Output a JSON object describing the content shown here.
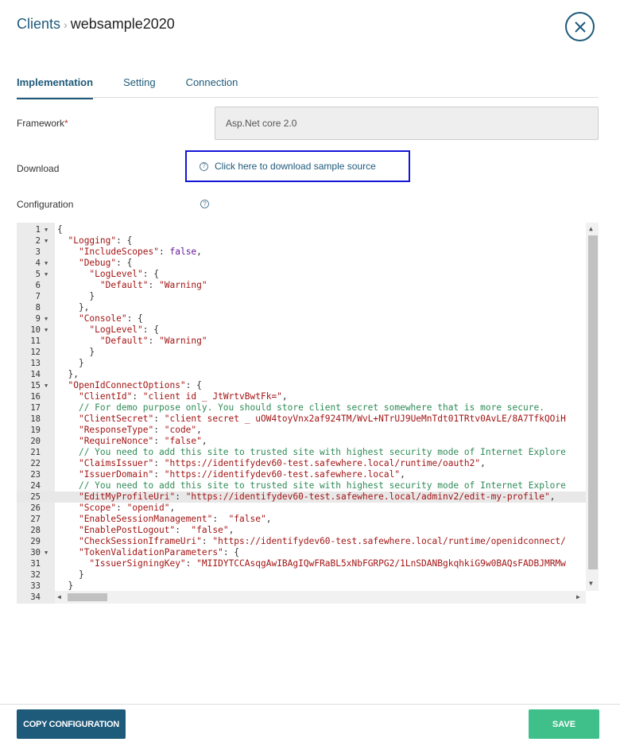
{
  "breadcrumb": {
    "parent": "Clients",
    "separator": "›",
    "current": "websample2020"
  },
  "tabs": [
    {
      "label": "Implementation",
      "active": true
    },
    {
      "label": "Setting",
      "active": false
    },
    {
      "label": "Connection",
      "active": false
    }
  ],
  "form": {
    "framework_label": "Framework",
    "required_mark": "*",
    "framework_value": "Asp.Net core 2.0",
    "download_label": "Download",
    "download_link": "Click here to download sample source",
    "configuration_label": "Configuration"
  },
  "editor": {
    "highlighted_line": 25,
    "lines": [
      {
        "n": "1",
        "fold": true,
        "html": "{"
      },
      {
        "n": "2",
        "fold": true,
        "html": "  <span class='k'>\"Logging\"</span>: {"
      },
      {
        "n": "3",
        "fold": false,
        "html": "    <span class='k'>\"IncludeScopes\"</span>: <span class='b'>false</span>,"
      },
      {
        "n": "4",
        "fold": true,
        "html": "    <span class='k'>\"Debug\"</span>: {"
      },
      {
        "n": "5",
        "fold": true,
        "html": "      <span class='k'>\"LogLevel\"</span>: {"
      },
      {
        "n": "6",
        "fold": false,
        "html": "        <span class='k'>\"Default\"</span>: <span class='s'>\"Warning\"</span>"
      },
      {
        "n": "7",
        "fold": false,
        "html": "      }"
      },
      {
        "n": "8",
        "fold": false,
        "html": "    },"
      },
      {
        "n": "9",
        "fold": true,
        "html": "    <span class='k'>\"Console\"</span>: {"
      },
      {
        "n": "10",
        "fold": true,
        "html": "      <span class='k'>\"LogLevel\"</span>: {"
      },
      {
        "n": "11",
        "fold": false,
        "html": "        <span class='k'>\"Default\"</span>: <span class='s'>\"Warning\"</span>"
      },
      {
        "n": "12",
        "fold": false,
        "html": "      }"
      },
      {
        "n": "13",
        "fold": false,
        "html": "    }"
      },
      {
        "n": "14",
        "fold": false,
        "html": "  },"
      },
      {
        "n": "15",
        "fold": true,
        "html": "  <span class='k'>\"OpenIdConnectOptions\"</span>: {"
      },
      {
        "n": "16",
        "fold": false,
        "html": "    <span class='k'>\"ClientId\"</span>: <span class='s'>\"client id _ JtWrtvBwtFk=\"</span>,"
      },
      {
        "n": "17",
        "fold": false,
        "html": "    <span class='c'>// For demo purpose only. You should store client secret somewhere that is more secure.</span>"
      },
      {
        "n": "18",
        "fold": false,
        "html": "    <span class='k'>\"ClientSecret\"</span>: <span class='s'>\"client secret _ uOW4toyVnx2af924TM/WvL+NTrUJ9UeMnTdt01TRtv0AvLE/8A7TfkQOiH</span>"
      },
      {
        "n": "19",
        "fold": false,
        "html": "    <span class='k'>\"ResponseType\"</span>: <span class='s'>\"code\"</span>,"
      },
      {
        "n": "20",
        "fold": false,
        "html": "    <span class='k'>\"RequireNonce\"</span>: <span class='s'>\"false\"</span>,"
      },
      {
        "n": "21",
        "fold": false,
        "html": "    <span class='c'>// You need to add this site to trusted site with highest security mode of Internet Explore</span>"
      },
      {
        "n": "22",
        "fold": false,
        "html": "    <span class='k'>\"ClaimsIssuer\"</span>: <span class='s'>\"https://identifydev60-test.safewhere.local/runtime/oauth2\"</span>,"
      },
      {
        "n": "23",
        "fold": false,
        "html": "    <span class='k'>\"IssuerDomain\"</span>: <span class='s'>\"https://identifydev60-test.safewhere.local\"</span>,"
      },
      {
        "n": "24",
        "fold": false,
        "html": "    <span class='c'>// You need to add this site to trusted site with highest security mode of Internet Explore</span>"
      },
      {
        "n": "25",
        "fold": false,
        "html": "    <span class='k'>\"EditMyProfileUri\"</span>: <span class='s'>\"https://identifydev60-test.safewhere.local/adminv2/edit-my-profile\"</span>,"
      },
      {
        "n": "26",
        "fold": false,
        "html": "    <span class='k'>\"Scope\"</span>: <span class='s'>\"openid\"</span>,"
      },
      {
        "n": "27",
        "fold": false,
        "html": "    <span class='k'>\"EnableSessionManagement\"</span>:  <span class='s'>\"false\"</span>,"
      },
      {
        "n": "28",
        "fold": false,
        "html": "    <span class='k'>\"EnablePostLogout\"</span>:  <span class='s'>\"false\"</span>,"
      },
      {
        "n": "29",
        "fold": false,
        "html": "    <span class='k'>\"CheckSessionIframeUri\"</span>: <span class='s'>\"https://identifydev60-test.safewhere.local/runtime/openidconnect/</span>"
      },
      {
        "n": "30",
        "fold": true,
        "html": "    <span class='k'>\"TokenValidationParameters\"</span>: {"
      },
      {
        "n": "31",
        "fold": false,
        "html": "      <span class='k'>\"IssuerSigningKey\"</span>: <span class='s'>\"MIIDYTCCAsqgAwIBAgIQwFRaBL5xNbFGRPG2/1LnSDANBgkqhkiG9w0BAQsFADBJMRMw</span>"
      },
      {
        "n": "32",
        "fold": false,
        "html": "    }"
      },
      {
        "n": "33",
        "fold": false,
        "html": "  }"
      },
      {
        "n": "34",
        "fold": false,
        "html": ""
      }
    ]
  },
  "buttons": {
    "copy": "COPY CONFIGURATION",
    "save": "SAVE"
  },
  "colors": {
    "primary": "#1e5a7a",
    "save": "#3fbf89",
    "highlight_border": "#1414d6"
  },
  "icons": {
    "close": "close-icon",
    "help": "help-icon"
  }
}
